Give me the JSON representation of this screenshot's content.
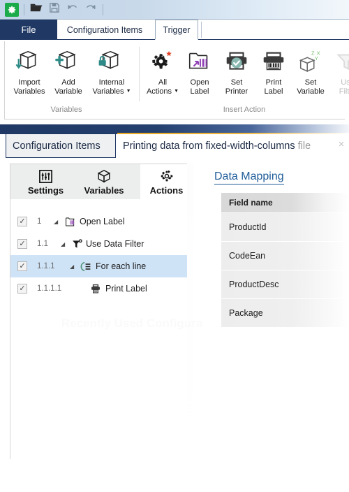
{
  "quick_access": {
    "items": [
      {
        "name": "app-menu",
        "icon": "gear-icon"
      },
      {
        "name": "open",
        "icon": "folder-open-icon"
      },
      {
        "name": "save",
        "icon": "save-disk-icon"
      },
      {
        "name": "undo",
        "icon": "undo-arrow-icon"
      },
      {
        "name": "redo",
        "icon": "redo-arrow-icon"
      }
    ]
  },
  "ribbon": {
    "tabs": [
      {
        "label": "File",
        "active": false,
        "style": "file"
      },
      {
        "label": "Configuration Items",
        "active": false,
        "style": "normal"
      },
      {
        "label": "Trigger",
        "active": true,
        "style": "normal"
      }
    ],
    "groups": [
      {
        "label": "Variables",
        "items": [
          {
            "line1": "Import",
            "line2": "Variables",
            "icon": "box-import-icon",
            "dropdown": false,
            "disabled": false
          },
          {
            "line1": "Add",
            "line2": "Variable",
            "icon": "box-add-icon",
            "dropdown": false,
            "disabled": false
          },
          {
            "line1": "Internal",
            "line2": "Variables",
            "icon": "box-lock-icon",
            "dropdown": true,
            "disabled": false
          }
        ]
      },
      {
        "label": "Insert Action",
        "items": [
          {
            "line1": "All",
            "line2": "Actions",
            "icon": "gear-star-icon",
            "dropdown": true,
            "disabled": false
          },
          {
            "line1": "Open",
            "line2": "Label",
            "icon": "folder-label-icon",
            "dropdown": false,
            "disabled": false
          },
          {
            "line1": "Set",
            "line2": "Printer",
            "icon": "printer-check-icon",
            "dropdown": false,
            "disabled": false
          },
          {
            "line1": "Print",
            "line2": "Label",
            "icon": "printer-barcode-icon",
            "dropdown": false,
            "disabled": false
          },
          {
            "line1": "Set",
            "line2": "Variable",
            "icon": "box-xyz-icon",
            "dropdown": false,
            "disabled": false
          },
          {
            "line1": "Use",
            "line2": "Filter",
            "icon": "funnel-icon",
            "dropdown": false,
            "disabled": true
          }
        ]
      }
    ]
  },
  "document_tabs": {
    "inactive": {
      "label": "Configuration Items"
    },
    "active": {
      "title": "Printing data from fixed-width-columns",
      "suffix": "file",
      "close_icon": "close-icon",
      "close_label": "×"
    }
  },
  "left_panel": {
    "tabs": [
      {
        "label": "Settings",
        "icon": "sliders-icon",
        "active": false
      },
      {
        "label": "Variables",
        "icon": "box-icon",
        "active": false
      },
      {
        "label": "Actions",
        "icon": "gear-icon",
        "active": true
      }
    ],
    "tree": [
      {
        "checked": true,
        "check_glyph": "✓",
        "number": "1",
        "expander": "◢",
        "icon": "open-label-icon",
        "label": "Open Label",
        "selected": false,
        "indent": 0
      },
      {
        "checked": true,
        "check_glyph": "✓",
        "number": "1.1",
        "expander": "◢",
        "icon": "funnel-filter-icon",
        "label": "Use Data Filter",
        "selected": false,
        "indent": 1
      },
      {
        "checked": true,
        "check_glyph": "✓",
        "number": "1.1.1",
        "expander": "◢",
        "icon": "for-each-line-icon",
        "label": "For each line",
        "selected": true,
        "indent": 2
      },
      {
        "checked": true,
        "check_glyph": "✓",
        "number": "1.1.1.1",
        "expander": "",
        "icon": "printer-icon",
        "label": "Print Label",
        "selected": false,
        "indent": 3
      }
    ],
    "ghost_text": "Recently Used Configurations"
  },
  "right_panel": {
    "title": "Data Mapping",
    "table": {
      "columns": [
        "Field name"
      ],
      "rows": [
        "ProductId",
        "CodeEan",
        "ProductDesc",
        "Package"
      ]
    }
  },
  "colors": {
    "accent_navy": "#1f3864",
    "accent_gold": "#e8a722",
    "link_blue": "#1f5c99",
    "selection_blue": "#cfe3f7",
    "teal": "#2e8b87",
    "green": "#1bab4a",
    "purple": "#8f3fb5"
  }
}
